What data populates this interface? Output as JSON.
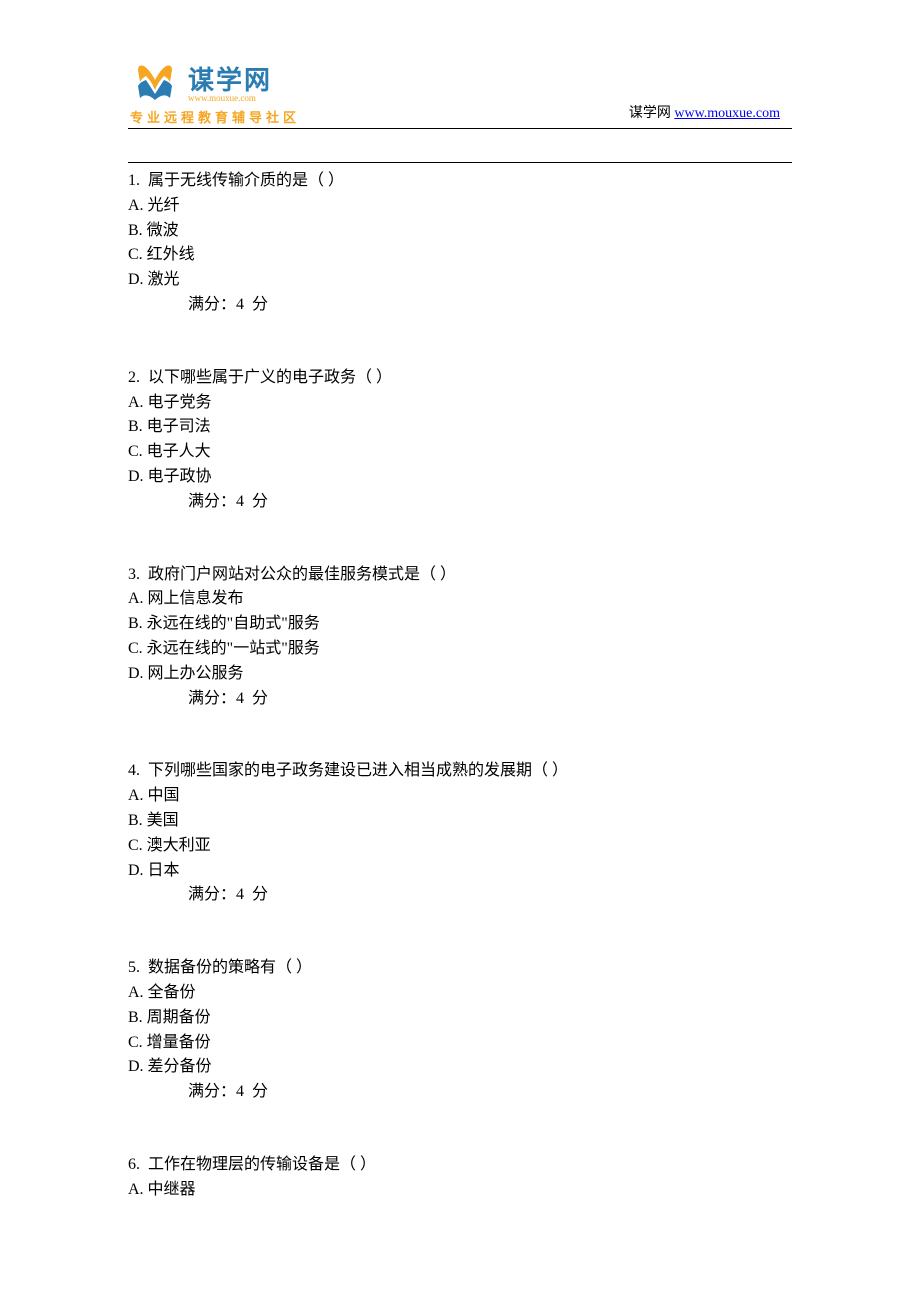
{
  "header": {
    "logo_text": "谋学网",
    "logo_url": "www.mouxue.com",
    "logo_subtitle": "专业远程教育辅导社区",
    "site_name": "谋学网",
    "site_link": "www.mouxue.com"
  },
  "questions": [
    {
      "num": "1.",
      "text": "属于无线传输介质的是（ ）",
      "options": [
        {
          "label": "A.",
          "text": "光纤"
        },
        {
          "label": "B.",
          "text": "微波"
        },
        {
          "label": "C.",
          "text": "红外线"
        },
        {
          "label": "D.",
          "text": "激光"
        }
      ],
      "score": "满分：4  分"
    },
    {
      "num": "2.",
      "text": "以下哪些属于广义的电子政务（ ）",
      "options": [
        {
          "label": "A.",
          "text": "电子党务"
        },
        {
          "label": "B.",
          "text": "电子司法"
        },
        {
          "label": "C.",
          "text": "电子人大"
        },
        {
          "label": "D.",
          "text": "电子政协"
        }
      ],
      "score": "满分：4  分"
    },
    {
      "num": "3.",
      "text": "政府门户网站对公众的最佳服务模式是（ ）",
      "options": [
        {
          "label": "A.",
          "text": "网上信息发布"
        },
        {
          "label": "B.",
          "text": "永远在线的\"自助式\"服务"
        },
        {
          "label": "C.",
          "text": "永远在线的\"一站式\"服务"
        },
        {
          "label": "D.",
          "text": "网上办公服务"
        }
      ],
      "score": "满分：4  分"
    },
    {
      "num": "4.",
      "text": "下列哪些国家的电子政务建设已进入相当成熟的发展期（ ）",
      "options": [
        {
          "label": "A.",
          "text": "中国"
        },
        {
          "label": "B.",
          "text": "美国"
        },
        {
          "label": "C.",
          "text": "澳大利亚"
        },
        {
          "label": "D.",
          "text": "日本"
        }
      ],
      "score": "满分：4  分"
    },
    {
      "num": "5.",
      "text": "数据备份的策略有（ ）",
      "options": [
        {
          "label": "A.",
          "text": "全备份"
        },
        {
          "label": "B.",
          "text": "周期备份"
        },
        {
          "label": "C.",
          "text": "增量备份"
        },
        {
          "label": "D.",
          "text": "差分备份"
        }
      ],
      "score": "满分：4  分"
    },
    {
      "num": "6.",
      "text": "工作在物理层的传输设备是（ ）",
      "options": [
        {
          "label": "A.",
          "text": "中继器"
        }
      ],
      "score": null
    }
  ]
}
